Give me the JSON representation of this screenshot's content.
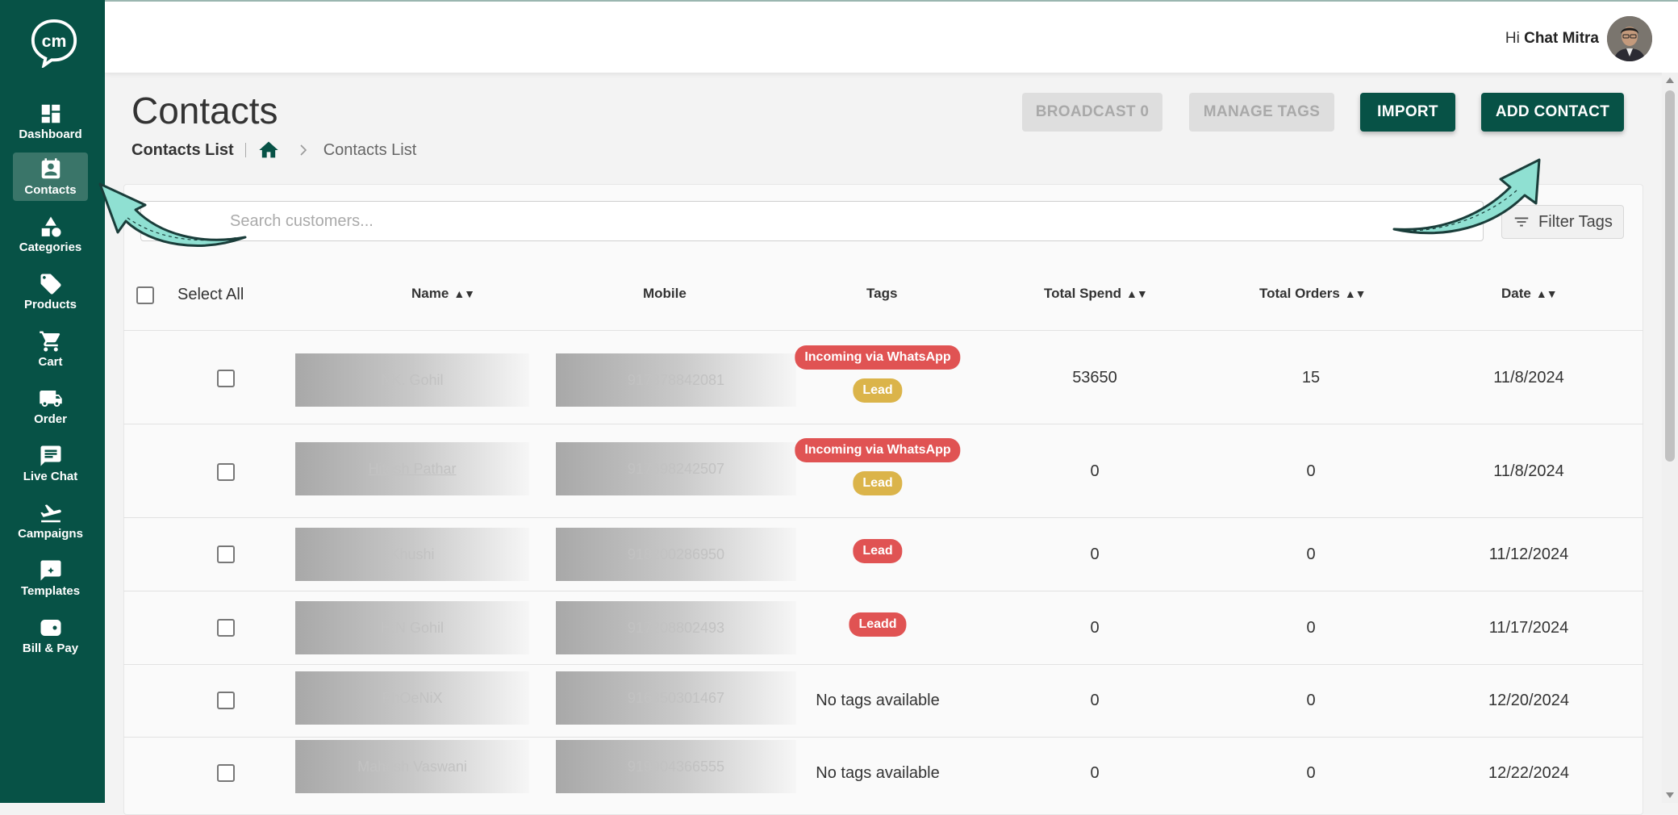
{
  "sidebar": {
    "items": [
      {
        "label": "Dashboard",
        "icon": "dashboard-icon"
      },
      {
        "label": "Contacts",
        "icon": "contacts-icon",
        "active": true
      },
      {
        "label": "Categories",
        "icon": "categories-icon"
      },
      {
        "label": "Products",
        "icon": "tag-icon"
      },
      {
        "label": "Cart",
        "icon": "cart-icon"
      },
      {
        "label": "Order",
        "icon": "truck-icon"
      },
      {
        "label": "Live Chat",
        "icon": "chat-icon"
      },
      {
        "label": "Campaigns",
        "icon": "plane-icon"
      },
      {
        "label": "Templates",
        "icon": "template-icon"
      },
      {
        "label": "Bill & Pay",
        "icon": "wallet-icon"
      }
    ]
  },
  "topbar": {
    "greeting_prefix": "Hi",
    "user_name": "Chat Mitra"
  },
  "page": {
    "title": "Contacts",
    "breadcrumb_current": "Contacts List",
    "breadcrumb_link": "Contacts List"
  },
  "actions": {
    "broadcast": "BROADCAST 0",
    "manage_tags": "MANAGE TAGS",
    "import": "IMPORT",
    "add_contact": "ADD CONTACT"
  },
  "search": {
    "placeholder": "Search customers..."
  },
  "filter": {
    "label": "Filter Tags"
  },
  "table": {
    "select_all": "Select All",
    "columns": {
      "name": "Name",
      "mobile": "Mobile",
      "tags": "Tags",
      "spend": "Total Spend",
      "orders": "Total Orders",
      "date": "Date"
    },
    "sort_glyph": "▲▼",
    "rows": [
      {
        "name": "NK. Gohil",
        "mobile": "917878842081",
        "tags": [
          "Incoming via WhatsApp",
          "Lead"
        ],
        "spend": "53650",
        "orders": "15",
        "date": "11/8/2024"
      },
      {
        "name": "Hitesh Pathar",
        "mobile": "917698242507",
        "tags": [
          "Incoming via WhatsApp",
          "Lead"
        ],
        "spend": "0",
        "orders": "0",
        "date": "11/8/2024"
      },
      {
        "name": "Khushi",
        "mobile": "918200286950",
        "tags": [
          "Lead"
        ],
        "spend": "0",
        "orders": "0",
        "date": "11/12/2024"
      },
      {
        "name": "H.N Gohil",
        "mobile": "917208802493",
        "tags": [
          "Leadd"
        ],
        "spend": "0",
        "orders": "0",
        "date": "11/17/2024"
      },
      {
        "name": "PhOeNiX",
        "mobile": "916350301467",
        "no_tags": "No tags available",
        "spend": "0",
        "orders": "0",
        "date": "12/20/2024"
      },
      {
        "name": "Mahesh Vaswani",
        "mobile": "919904366555",
        "no_tags": "No tags available",
        "spend": "0",
        "orders": "0",
        "date": "12/22/2024"
      }
    ]
  },
  "colors": {
    "brand": "#075246",
    "tag_red": "#e05353",
    "tag_gold": "#dbb44a",
    "annotation_arrow": "#8fe0d2"
  }
}
